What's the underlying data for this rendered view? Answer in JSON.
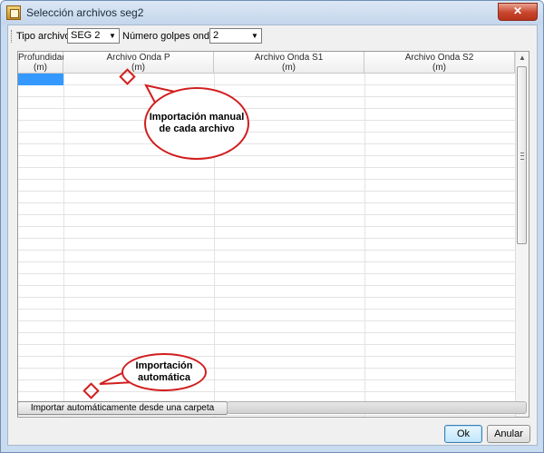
{
  "window": {
    "title": "Selección archivos seg2",
    "close_label": "✕"
  },
  "toolbar": {
    "tipo_label": "Tipo archivo",
    "tipo_value": "SEG 2",
    "golpes_label": "Número golpes onda S",
    "golpes_value": "2"
  },
  "grid": {
    "columns": [
      {
        "title": "Profundidad",
        "unit": "(m)"
      },
      {
        "title": "Archivo Onda P",
        "unit": "(m)"
      },
      {
        "title": "Archivo Onda S1",
        "unit": "(m)"
      },
      {
        "title": "Archivo Onda S2",
        "unit": "(m)"
      }
    ]
  },
  "annotations": {
    "manual": "Importación manual de cada archivo",
    "auto": "Importación automática"
  },
  "buttons": {
    "import_folder": "Importar automáticamente desde una carpeta",
    "ok": "Ok",
    "cancel": "Anular"
  },
  "colors": {
    "callout_border": "#d21e1e",
    "selection": "#3399ff"
  }
}
